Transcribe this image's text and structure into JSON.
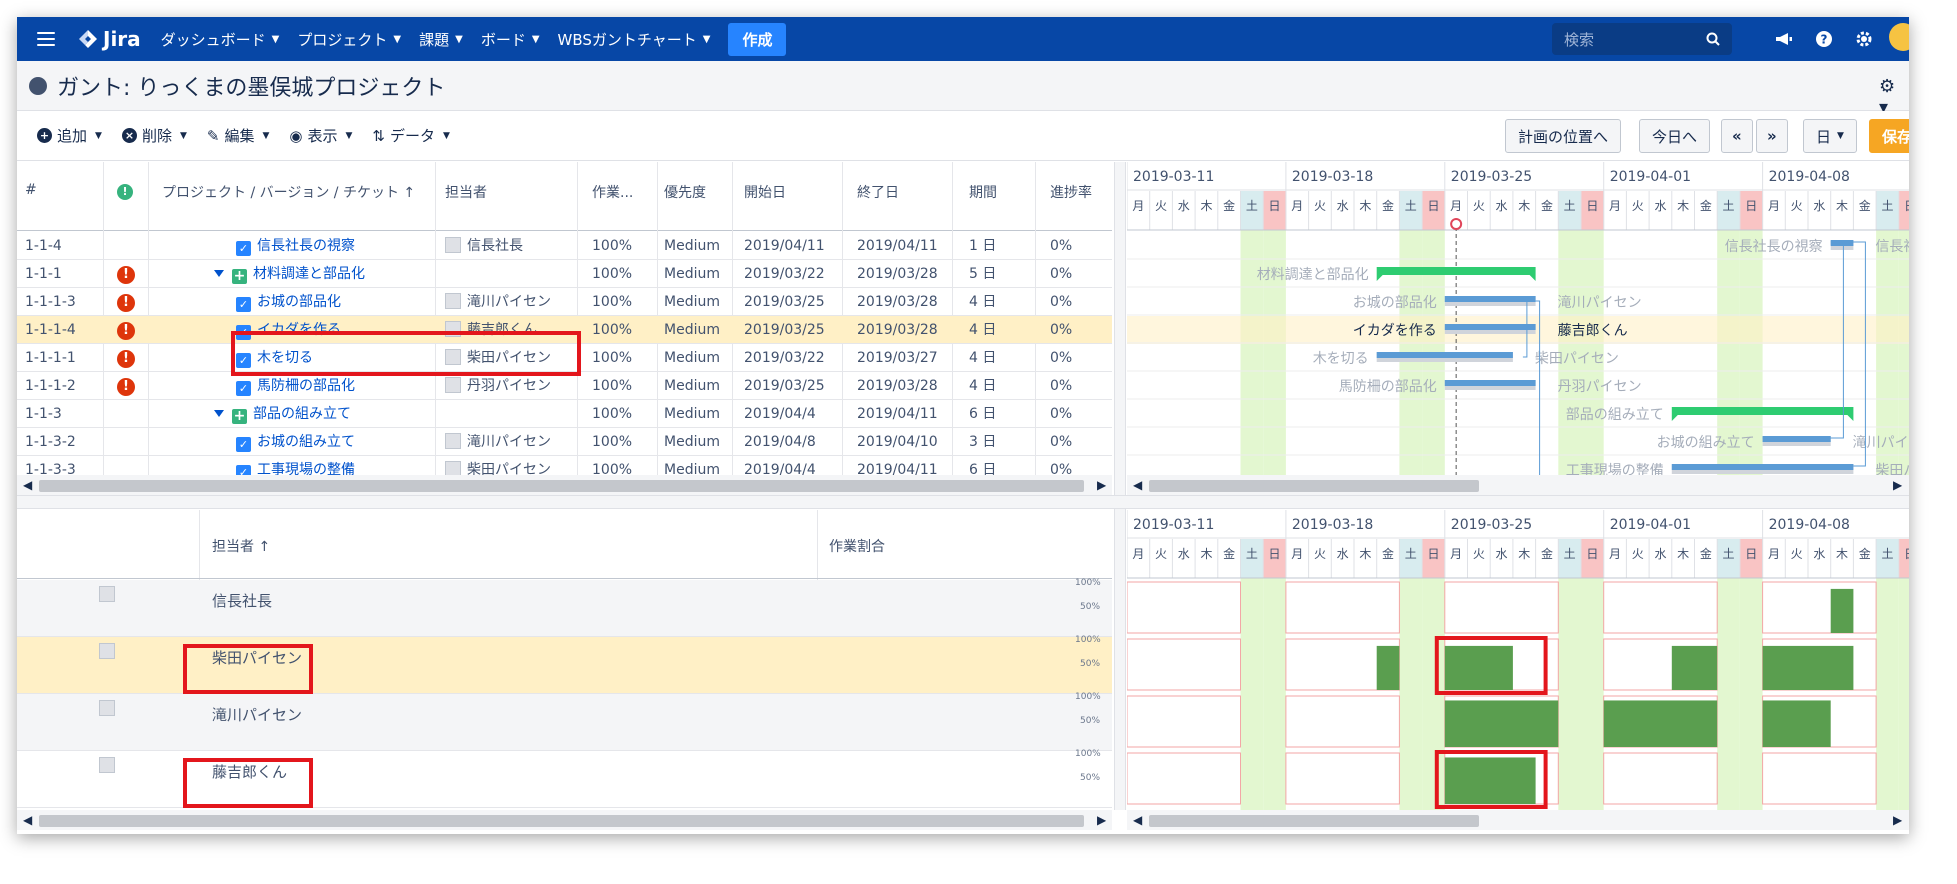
{
  "nav": {
    "logo": "Jira",
    "menu": [
      "ダッシュボード",
      "プロジェクト",
      "課題",
      "ボード",
      "WBSガントチャート"
    ],
    "create": "作成",
    "search_placeholder": "検索"
  },
  "page": {
    "title": "ガント: りっくまの墨俣城プロジェクト"
  },
  "toolbar": {
    "add": "追加",
    "delete": "削除",
    "edit": "編集",
    "view": "表示",
    "data": "データ",
    "plan_position": "計画の位置へ",
    "today": "今日へ",
    "prev": "«",
    "next": "»",
    "scale": "日",
    "save": "保存"
  },
  "task_grid": {
    "columns": [
      "#",
      "",
      "プロジェクト / バージョン / チケット",
      "担当者",
      "作業...",
      "優先度",
      "開始日",
      "終了日",
      "期間",
      "進捗率"
    ],
    "sort_mark": "↑",
    "rows": [
      {
        "id": "1-1-4",
        "warn": "",
        "type": "task",
        "name": "信長社長の視察",
        "assignee": "信長社長",
        "work": "100%",
        "priority": "Medium",
        "start": "2019/04/11",
        "end": "2019/04/11",
        "duration": "1 日",
        "progress": "0%"
      },
      {
        "id": "1-1-1",
        "warn": "!",
        "type": "group",
        "name": "材料調達と部品化",
        "assignee": "",
        "work": "100%",
        "priority": "Medium",
        "start": "2019/03/22",
        "end": "2019/03/28",
        "duration": "5 日",
        "progress": "0%"
      },
      {
        "id": "1-1-1-3",
        "warn": "!",
        "type": "task",
        "name": "お城の部品化",
        "assignee": "滝川パイセン",
        "work": "100%",
        "priority": "Medium",
        "start": "2019/03/25",
        "end": "2019/03/28",
        "duration": "4 日",
        "progress": "0%"
      },
      {
        "id": "1-1-1-4",
        "warn": "!",
        "type": "task",
        "name": "イカダを作る",
        "assignee": "藤吉郎くん",
        "work": "100%",
        "priority": "Medium",
        "start": "2019/03/25",
        "end": "2019/03/28",
        "duration": "4 日",
        "progress": "0%"
      },
      {
        "id": "1-1-1-1",
        "warn": "!",
        "type": "task",
        "name": "木を切る",
        "assignee": "柴田パイセン",
        "work": "100%",
        "priority": "Medium",
        "start": "2019/03/22",
        "end": "2019/03/27",
        "duration": "4 日",
        "progress": "0%"
      },
      {
        "id": "1-1-1-2",
        "warn": "!",
        "type": "task",
        "name": "馬防柵の部品化",
        "assignee": "丹羽パイセン",
        "work": "100%",
        "priority": "Medium",
        "start": "2019/03/25",
        "end": "2019/03/28",
        "duration": "4 日",
        "progress": "0%"
      },
      {
        "id": "1-1-3",
        "warn": "",
        "type": "group",
        "name": "部品の組み立て",
        "assignee": "",
        "work": "100%",
        "priority": "Medium",
        "start": "2019/04/4",
        "end": "2019/04/11",
        "duration": "6 日",
        "progress": "0%"
      },
      {
        "id": "1-1-3-2",
        "warn": "",
        "type": "task",
        "name": "お城の組み立て",
        "assignee": "滝川パイセン",
        "work": "100%",
        "priority": "Medium",
        "start": "2019/04/8",
        "end": "2019/04/10",
        "duration": "3 日",
        "progress": "0%"
      },
      {
        "id": "1-1-3-3",
        "warn": "",
        "type": "task",
        "name": "工事現場の整備",
        "assignee": "柴田パイセン",
        "work": "100%",
        "priority": "Medium",
        "start": "2019/04/4",
        "end": "2019/04/11",
        "duration": "6 日",
        "progress": "0%"
      }
    ]
  },
  "timeline": {
    "weeks": [
      "2019-03-11",
      "2019-03-18",
      "2019-03-25",
      "2019-04-01",
      "2019-04-08"
    ],
    "weekdays": [
      "月",
      "火",
      "水",
      "木",
      "金",
      "土",
      "日"
    ]
  },
  "gantt_labels": {
    "r0": "信長社長の視察",
    "r0b": "信長社",
    "r1": "材料調達と部品化",
    "r2": "お城の部品化",
    "r2b": "滝川パイセン",
    "r3": "イカダを作る",
    "r3b": "藤吉郎くん",
    "r4": "木を切る",
    "r4b": "柴田パイセン",
    "r5": "馬防柵の部品化",
    "r5b": "丹羽パイセン",
    "r6": "部品の組み立て",
    "r7": "お城の組み立て",
    "r7b": "滝川パイ",
    "r8": "工事現場の整備",
    "r8b": "柴田パイ"
  },
  "resource_grid": {
    "columns": [
      "担当者",
      "作業割合"
    ],
    "sort_mark": "↑",
    "rows": [
      {
        "name": "信長社長"
      },
      {
        "name": "柴田パイセン"
      },
      {
        "name": "滝川パイセン"
      },
      {
        "name": "藤吉郎くん"
      }
    ],
    "scale_labels": [
      "100%",
      "50%"
    ]
  },
  "resource_chart": {
    "start_date": "2019-03-11",
    "rows": [
      {
        "name": "信長社長",
        "bars": [
          {
            "from": 31,
            "to": 32,
            "load": 0.9
          }
        ]
      },
      {
        "name": "柴田パイセン",
        "bars": [
          {
            "from": 11,
            "to": 12,
            "load": 0.9
          },
          {
            "from": 14,
            "to": 17,
            "load": 0.9
          },
          {
            "from": 24,
            "to": 26,
            "load": 0.9
          },
          {
            "from": 28,
            "to": 32,
            "load": 0.9
          }
        ]
      },
      {
        "name": "滝川パイセン",
        "bars": [
          {
            "from": 14,
            "to": 19,
            "load": 0.95
          },
          {
            "from": 21,
            "to": 26,
            "load": 0.95
          },
          {
            "from": 28,
            "to": 31,
            "load": 0.95
          }
        ]
      },
      {
        "name": "藤吉郎くん",
        "bars": [
          {
            "from": 14,
            "to": 18,
            "load": 0.95
          }
        ]
      }
    ],
    "colors": {
      "bar": "#5a9e4f",
      "weekend": "#e3f7d0",
      "holiday": "#f9c4c4",
      "grid": "#f3a6a6"
    }
  },
  "colors": {
    "nav_bg": "#0747a6",
    "accent": "#2684ff",
    "selected_row": "#fff0c6",
    "highlight_box": "#e3161c",
    "task_bar": "#5b9bd5",
    "group_bar": "#2ecc71",
    "today_line": "#e0455a"
  }
}
